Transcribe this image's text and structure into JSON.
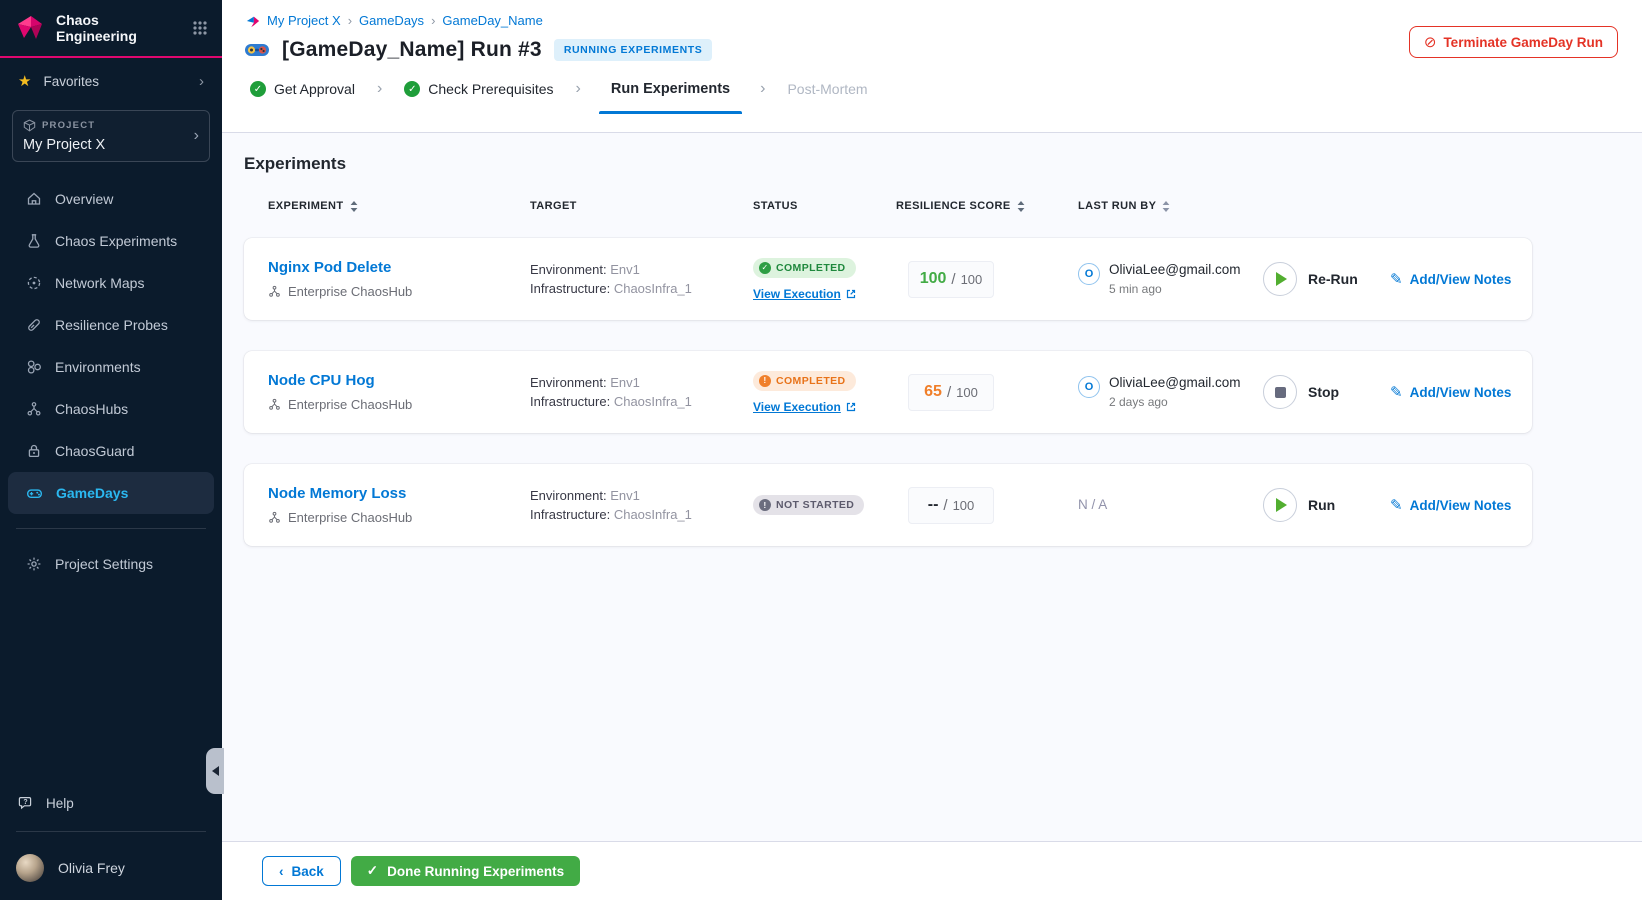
{
  "colors": {
    "accent_blue": "#0278d5",
    "brand_pink": "#e0076f",
    "success_green": "#42ab45",
    "warning_orange": "#f07f2a",
    "sidebar_bg": "#0b1b2c",
    "active_nav_blue": "#2bb8f0",
    "terminate_red": "#e43326"
  },
  "sidebar": {
    "app_title": "Chaos Engineering",
    "favorites_label": "Favorites",
    "project_label": "PROJECT",
    "project_name": "My Project X",
    "nav": [
      {
        "icon": "home-icon",
        "label": "Overview",
        "active": false
      },
      {
        "icon": "flask-icon",
        "label": "Chaos Experiments",
        "active": false
      },
      {
        "icon": "network-icon",
        "label": "Network Maps",
        "active": false
      },
      {
        "icon": "probe-icon",
        "label": "Resilience Probes",
        "active": false
      },
      {
        "icon": "environments-icon",
        "label": "Environments",
        "active": false
      },
      {
        "icon": "molecule-icon",
        "label": "ChaosHubs",
        "active": false
      },
      {
        "icon": "lock-icon",
        "label": "ChaosGuard",
        "active": false
      },
      {
        "icon": "gamepad-icon",
        "label": "GameDays",
        "active": true
      }
    ],
    "settings_label": "Project Settings",
    "help_label": "Help",
    "user_name": "Olivia Frey"
  },
  "header": {
    "breadcrumb": {
      "items": [
        "My Project X",
        "GameDays",
        "GameDay_Name"
      ]
    },
    "title": "[GameDay_Name] Run #3",
    "badge": "RUNNING EXPERIMENTS",
    "terminate_label": "Terminate GameDay Run",
    "steps": [
      {
        "label": "Get Approval",
        "state": "done"
      },
      {
        "label": "Check Prerequisites",
        "state": "done"
      },
      {
        "label": "Run Experiments",
        "state": "active"
      },
      {
        "label": "Post-Mortem",
        "state": "upcoming"
      }
    ]
  },
  "content": {
    "section_title": "Experiments",
    "columns": [
      {
        "label": "EXPERIMENT",
        "sortable": true
      },
      {
        "label": "TARGET",
        "sortable": false
      },
      {
        "label": "STATUS",
        "sortable": false
      },
      {
        "label": "RESILIENCE SCORE",
        "sortable": true
      },
      {
        "label": "LAST RUN BY",
        "sortable": true
      }
    ],
    "rows": [
      {
        "name": "Nginx Pod Delete",
        "hub": "Enterprise ChaosHub",
        "env_label": "Environment:",
        "env": "Env1",
        "infra_label": "Infrastructure:",
        "infra": "ChaosInfra_1",
        "status": "COMPLETED",
        "status_type": "success",
        "view_execution": "View Execution",
        "score": "100",
        "score_slash": "/",
        "score_max": "100",
        "user": "OliviaLee@gmail.com",
        "avatar_letter": "O",
        "time": "5 min ago",
        "action": "Re-Run",
        "action_icon": "play",
        "notes": "Add/View Notes"
      },
      {
        "name": "Node CPU Hog",
        "hub": "Enterprise ChaosHub",
        "env_label": "Environment:",
        "env": "Env1",
        "infra_label": "Infrastructure:",
        "infra": "ChaosInfra_1",
        "status": "COMPLETED",
        "status_type": "warning",
        "view_execution": "View Execution",
        "score": "65",
        "score_slash": "/",
        "score_max": "100",
        "user": "OliviaLee@gmail.com",
        "avatar_letter": "O",
        "time": "2 days ago",
        "action": "Stop",
        "action_icon": "stop",
        "notes": "Add/View Notes"
      },
      {
        "name": "Node Memory Loss",
        "hub": "Enterprise ChaosHub",
        "env_label": "Environment:",
        "env": "Env1",
        "infra_label": "Infrastructure:",
        "infra": "ChaosInfra_1",
        "status": "NOT STARTED",
        "status_type": "neutral",
        "score": "--",
        "score_slash": "/",
        "score_max": "100",
        "last_run": "N / A",
        "action": "Run",
        "action_icon": "play",
        "notes": "Add/View Notes"
      }
    ]
  },
  "footer": {
    "back_label": "Back",
    "done_label": "Done Running Experiments"
  }
}
